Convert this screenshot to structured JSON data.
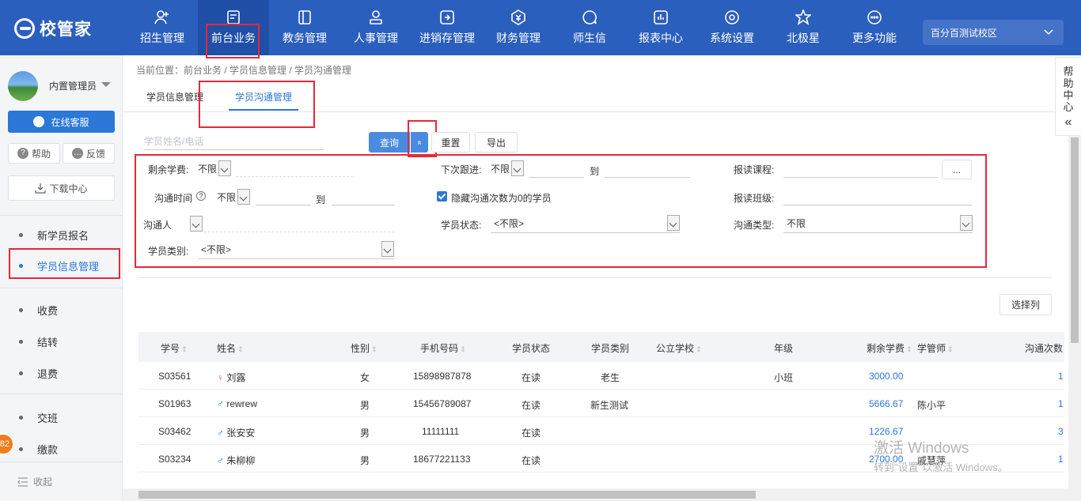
{
  "app": {
    "logo_text": "校管家",
    "nav": [
      {
        "label": "招生管理",
        "icon": "person-add-icon"
      },
      {
        "label": "前台业务",
        "icon": "desk-icon"
      },
      {
        "label": "教务管理",
        "icon": "book-icon"
      },
      {
        "label": "人事管理",
        "icon": "person-icon"
      },
      {
        "label": "进销存管理",
        "icon": "inventory-icon"
      },
      {
        "label": "财务管理",
        "icon": "finance-icon"
      },
      {
        "label": "师生信",
        "icon": "chat-icon"
      },
      {
        "label": "报表中心",
        "icon": "report-icon"
      },
      {
        "label": "系统设置",
        "icon": "settings-icon"
      },
      {
        "label": "北极星",
        "icon": "star-icon"
      },
      {
        "label": "更多功能",
        "icon": "more-icon"
      }
    ],
    "campus": "百分百测试校区",
    "colors": {
      "primary": "#2b5fbd",
      "accent": "#2b78d8",
      "highlight": "#e8283a"
    }
  },
  "sidebar": {
    "user": "内置管理员",
    "online_service": "在线客服",
    "help": "帮助",
    "feedback": "反馈",
    "download": "下载中心",
    "menu": [
      "新学员报名",
      "学员信息管理",
      "收费",
      "结转",
      "退费",
      "交班",
      "缴款"
    ],
    "badge": "82",
    "collapse": "收起"
  },
  "breadcrumb": "当前位置：前台业务 / 学员信息管理 / 学员沟通管理",
  "tabs": [
    "学员信息管理",
    "学员沟通管理"
  ],
  "help_panel": [
    "帮",
    "助",
    "中",
    "心",
    "«"
  ],
  "search": {
    "placeholder": "学员姓名/电话",
    "query": "查询",
    "toggle": "«",
    "reset": "重置",
    "export": "导出"
  },
  "filters": {
    "remaining_fee": {
      "label": "剩余学费:",
      "value": "不限"
    },
    "next_followup": {
      "label": "下次跟进:",
      "value": "不限",
      "to": "到"
    },
    "course": {
      "label": "报读课程:",
      "button": "..."
    },
    "comm_time": {
      "label": "沟通时间",
      "help": "?",
      "value": "不限",
      "to": "到"
    },
    "hide_zero": {
      "label": "隐藏沟通次数为0的学员",
      "checked": true
    },
    "class": {
      "label": "报读班级:"
    },
    "communicator": {
      "label": "沟通人"
    },
    "student_status": {
      "label": "学员状态:",
      "value": "<不限>"
    },
    "comm_type": {
      "label": "沟通类型:",
      "value": "不限"
    },
    "student_category": {
      "label": "学员类别:",
      "value": "<不限>"
    }
  },
  "select_columns": "选择列",
  "table": {
    "headers": [
      "学号",
      "姓名",
      "性别",
      "手机号码",
      "学员状态",
      "学员类别",
      "公立学校",
      "年级",
      "剩余学费",
      "学管师",
      "沟通次数"
    ],
    "rows": [
      {
        "id": "S03561",
        "gender_icon": "female-icon",
        "name": "刘露",
        "sex": "女",
        "phone": "15898987878",
        "status": "在读",
        "category": "老生",
        "school": "",
        "grade": "小班",
        "fee": "3000.00",
        "advisor": "",
        "count": "1"
      },
      {
        "id": "S01963",
        "gender_icon": "male-icon",
        "name": "rewrew",
        "sex": "男",
        "phone": "15456789087",
        "status": "在读",
        "category": "新生测试",
        "school": "",
        "grade": "",
        "fee": "5666.67",
        "advisor": "陈小平",
        "count": "1"
      },
      {
        "id": "S03462",
        "gender_icon": "male-icon",
        "name": "张安安",
        "sex": "男",
        "phone": "11111111",
        "status": "在读",
        "category": "",
        "school": "",
        "grade": "",
        "fee": "1226.67",
        "advisor": "",
        "count": "3"
      },
      {
        "id": "S03234",
        "gender_icon": "male-icon",
        "name": "朱柳柳",
        "sex": "男",
        "phone": "18677221133",
        "status": "在读",
        "category": "",
        "school": "",
        "grade": "",
        "fee": "2700.00",
        "advisor": "戚慧萍",
        "count": "1"
      }
    ]
  },
  "watermark": {
    "line1": "激活 Windows",
    "line2": "转到\"设置\"以激活 Windows。"
  }
}
